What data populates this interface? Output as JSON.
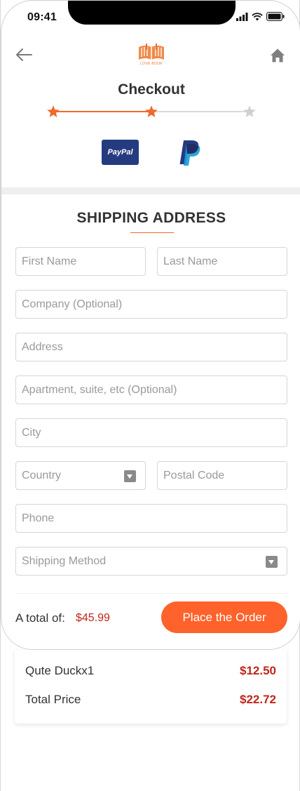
{
  "status_bar": {
    "time": "09:41"
  },
  "header": {
    "logo_text": "LOVE BOOK",
    "title": "Checkout"
  },
  "payment": {
    "paypal_label": "PayPal"
  },
  "shipping": {
    "title": "SHIPPING ADDRESS",
    "fields": {
      "first_name": "First Name",
      "last_name": "Last Name",
      "company": "Company  (Optional)",
      "address": "Address",
      "apartment": "Apartment, suite, etc  (Optional)",
      "city": "City",
      "country": "Country",
      "postal_code": "Postal Code",
      "phone": "Phone",
      "shipping_method": "Shipping Method"
    }
  },
  "footer": {
    "total_label": "A total of:",
    "total_value": "$45.99",
    "order_button": "Place the Order"
  },
  "summary": {
    "items": [
      {
        "label": "Qute Duckx1",
        "value": "$12.50"
      },
      {
        "label": "Total Price",
        "value": "$22.72"
      }
    ]
  },
  "colors": {
    "accent": "#ff622b",
    "price": "#c0261c",
    "paypal_blue": "#253b80"
  },
  "progress": {
    "steps_total": 3,
    "steps_completed": 2
  }
}
